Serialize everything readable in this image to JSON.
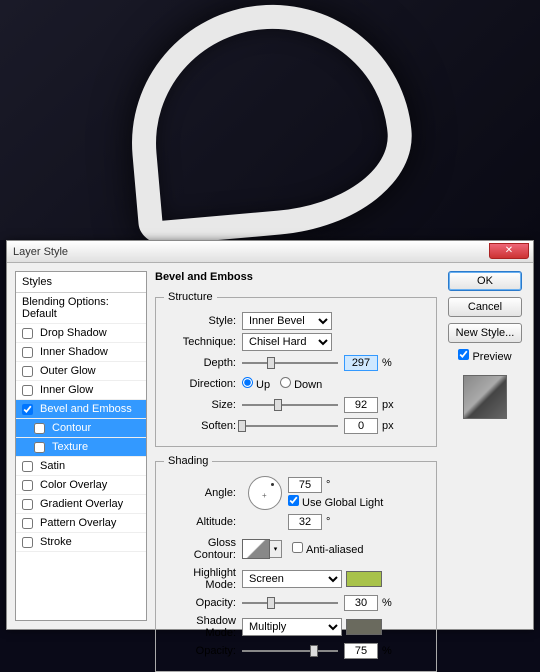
{
  "bg": {
    "letter": "D"
  },
  "dialog": {
    "title": "Layer Style",
    "styles_header": "Styles",
    "blending_opts": "Blending Options: Default",
    "items": [
      {
        "label": "Drop Shadow",
        "checked": false
      },
      {
        "label": "Inner Shadow",
        "checked": false
      },
      {
        "label": "Outer Glow",
        "checked": false
      },
      {
        "label": "Inner Glow",
        "checked": false
      },
      {
        "label": "Bevel and Emboss",
        "checked": true,
        "selected": true
      },
      {
        "label": "Contour",
        "checked": false,
        "sub": true,
        "selected": true
      },
      {
        "label": "Texture",
        "checked": false,
        "sub": true,
        "selected": true
      },
      {
        "label": "Satin",
        "checked": false
      },
      {
        "label": "Color Overlay",
        "checked": false
      },
      {
        "label": "Gradient Overlay",
        "checked": false
      },
      {
        "label": "Pattern Overlay",
        "checked": false
      },
      {
        "label": "Stroke",
        "checked": false
      }
    ]
  },
  "bevel": {
    "title": "Bevel and Emboss",
    "structure": {
      "legend": "Structure",
      "style_label": "Style:",
      "style_value": "Inner Bevel",
      "technique_label": "Technique:",
      "technique_value": "Chisel Hard",
      "depth_label": "Depth:",
      "depth_value": "297",
      "depth_unit": "%",
      "direction_label": "Direction:",
      "direction_up": "Up",
      "direction_down": "Down",
      "size_label": "Size:",
      "size_value": "92",
      "size_unit": "px",
      "soften_label": "Soften:",
      "soften_value": "0",
      "soften_unit": "px"
    },
    "shading": {
      "legend": "Shading",
      "angle_label": "Angle:",
      "angle_value": "75",
      "global_light": "Use Global Light",
      "altitude_label": "Altitude:",
      "altitude_value": "32",
      "gloss_label": "Gloss Contour:",
      "antialiased": "Anti-aliased",
      "highlight_mode_label": "Highlight Mode:",
      "highlight_mode_value": "Screen",
      "highlight_color": "#a8c24a",
      "highlight_opacity_label": "Opacity:",
      "highlight_opacity": "30",
      "shadow_mode_label": "Shadow Mode:",
      "shadow_mode_value": "Multiply",
      "shadow_color": "#6a6a5e",
      "shadow_opacity_label": "Opacity:",
      "shadow_opacity": "75",
      "pct": "%",
      "deg": "°"
    }
  },
  "buttons": {
    "ok": "OK",
    "cancel": "Cancel",
    "new_style": "New Style...",
    "preview": "Preview"
  }
}
